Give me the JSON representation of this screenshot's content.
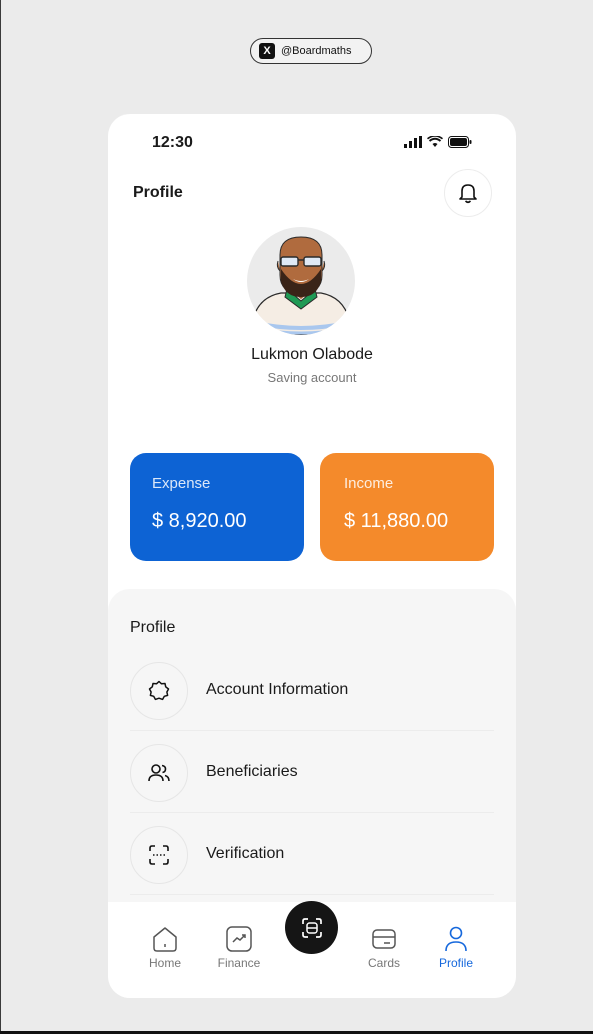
{
  "badge": {
    "icon": "x-logo-icon",
    "handle": "@Boardmaths"
  },
  "status_bar": {
    "time": "12:30",
    "icons": [
      "signal-icon",
      "wifi-icon",
      "battery-icon"
    ]
  },
  "header": {
    "title": "Profile",
    "notification_icon": "bell-icon"
  },
  "user": {
    "name": "Lukmon Olabode",
    "account_type": "Saving account"
  },
  "cards": [
    {
      "label": "Expense",
      "amount": "$ 8,920.00",
      "color": "#0d63d4"
    },
    {
      "label": "Income",
      "amount": "$ 11,880.00",
      "color": "#f48a2b"
    }
  ],
  "menu": {
    "title": "Profile",
    "items": [
      {
        "label": "Account Information",
        "icon": "badge-icon"
      },
      {
        "label": "Beneficiaries",
        "icon": "users-icon"
      },
      {
        "label": "Verification",
        "icon": "scan-icon"
      }
    ]
  },
  "tabbar": {
    "tabs": [
      {
        "label": "Home",
        "icon": "home-icon"
      },
      {
        "label": "Finance",
        "icon": "chart-icon"
      },
      {
        "label": "Cards",
        "icon": "card-icon"
      },
      {
        "label": "Profile",
        "icon": "user-icon",
        "active": true
      }
    ],
    "center_action_icon": "scan-icon"
  },
  "colors": {
    "accent": "#1668dc",
    "expense": "#0d63d4",
    "income": "#f48a2b"
  }
}
